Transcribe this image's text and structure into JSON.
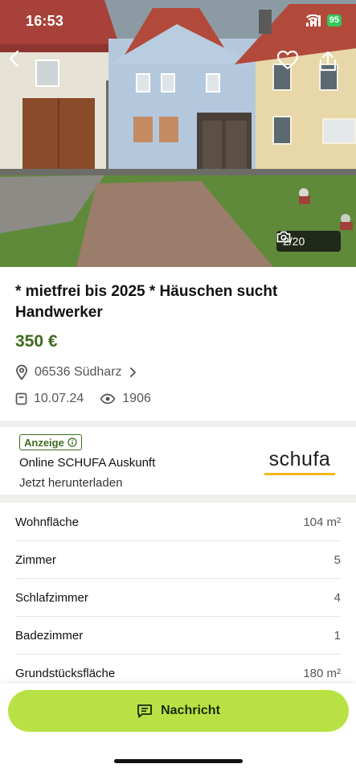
{
  "status_bar": {
    "time": "16:53",
    "battery": "95"
  },
  "gallery": {
    "counter": "2/20"
  },
  "listing": {
    "title": "* mietfrei bis 2025 * Häuschen sucht Handwerker",
    "price": "350 €",
    "location": "06536 Südharz",
    "date": "10.07.24",
    "views": "1906"
  },
  "ad": {
    "badge": "Anzeige",
    "title": "Online SCHUFA Auskunft",
    "subtitle": "Jetzt herunterladen",
    "logo_text": "schufa"
  },
  "details": [
    {
      "label": "Wohnfläche",
      "value": "104 m²"
    },
    {
      "label": "Zimmer",
      "value": "5"
    },
    {
      "label": "Schlafzimmer",
      "value": "4"
    },
    {
      "label": "Badezimmer",
      "value": "1"
    },
    {
      "label": "Grundstücksfläche",
      "value": "180 m²"
    }
  ],
  "cta": {
    "label": "Nachricht"
  },
  "colors": {
    "accent_green": "#3d6b1f",
    "cta_lime": "#b8e244",
    "schufa_yellow": "#f2b81d"
  },
  "icons": [
    "chevron-left-icon",
    "heart-icon",
    "share-icon",
    "camera-icon",
    "location-pin-icon",
    "chevron-right-icon",
    "calendar-icon",
    "eye-icon",
    "info-icon",
    "message-icon"
  ]
}
